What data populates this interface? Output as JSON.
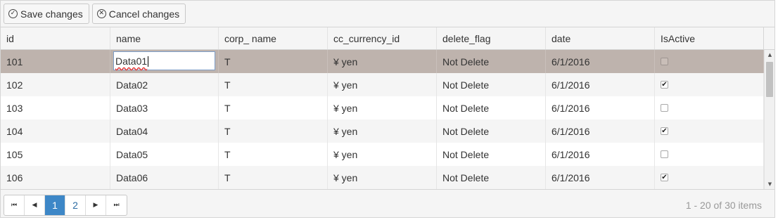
{
  "toolbar": {
    "save": {
      "label": "Save changes",
      "icon": "check-circle-icon",
      "glyph": "✓"
    },
    "cancel": {
      "label": "Cancel changes",
      "icon": "close-circle-icon",
      "glyph": "✕"
    }
  },
  "columns": [
    "id",
    "name",
    "corp_ name",
    "cc_currency_id",
    "delete_flag",
    "date",
    "IsActive"
  ],
  "rows": [
    {
      "id": "101",
      "name": "Data01",
      "corp": "T",
      "currency": "¥ yen",
      "delete_flag": "Not Delete",
      "date": "6/1/2016",
      "active": ""
    },
    {
      "id": "102",
      "name": "Data02",
      "corp": "T",
      "currency": "¥ yen",
      "delete_flag": "Not Delete",
      "date": "6/1/2016",
      "active": "✔"
    },
    {
      "id": "103",
      "name": "Data03",
      "corp": "T",
      "currency": "¥ yen",
      "delete_flag": "Not Delete",
      "date": "6/1/2016",
      "active": ""
    },
    {
      "id": "104",
      "name": "Data04",
      "corp": "T",
      "currency": "¥ yen",
      "delete_flag": "Not Delete",
      "date": "6/1/2016",
      "active": "✔"
    },
    {
      "id": "105",
      "name": "Data05",
      "corp": "T",
      "currency": "¥ yen",
      "delete_flag": "Not Delete",
      "date": "6/1/2016",
      "active": ""
    },
    {
      "id": "106",
      "name": "Data06",
      "corp": "T",
      "currency": "¥ yen",
      "delete_flag": "Not Delete",
      "date": "6/1/2016",
      "active": "✔"
    }
  ],
  "editing": {
    "row": 0,
    "value": "Data01"
  },
  "pager": {
    "first": "⏮",
    "prev": "◀",
    "next": "▶",
    "last": "⏭",
    "pages": [
      "1",
      "2"
    ],
    "current": "1",
    "info": "1 - 20 of 30 items"
  },
  "scrollbar": {
    "up": "▲",
    "down": "▼"
  },
  "colors": {
    "selected_row": "#beb3ad",
    "active_page": "#3d87c7",
    "alt_row": "#f5f5f5"
  }
}
